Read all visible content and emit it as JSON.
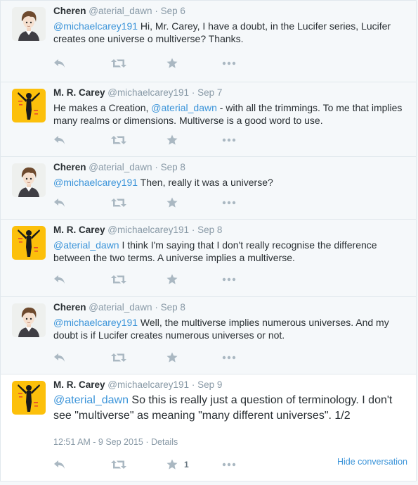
{
  "tweets": [
    {
      "name": "Cheren",
      "handle": "@aterial_dawn",
      "time": "Sep 6",
      "avatar": "cheren",
      "segments": [
        {
          "t": "@michaelcarey191",
          "m": true
        },
        {
          "t": " Hi, Mr. Carey, I have a doubt, in the Lucifer series, Lucifer creates one universe o multiverse? Thanks.",
          "m": false
        }
      ]
    },
    {
      "name": "M. R. Carey",
      "handle": "@michaelcarey191",
      "time": "Sep 7",
      "avatar": "carey",
      "segments": [
        {
          "t": "He makes a Creation, ",
          "m": false
        },
        {
          "t": "@aterial_dawn",
          "m": true
        },
        {
          "t": " - with all the trimmings. To me that implies many realms or dimensions. Multiverse is a good word to use.",
          "m": false
        }
      ]
    },
    {
      "name": "Cheren",
      "handle": "@aterial_dawn",
      "time": "Sep 8",
      "avatar": "cheren",
      "segments": [
        {
          "t": "@michaelcarey191",
          "m": true
        },
        {
          "t": " Then, really it was a universe?",
          "m": false
        }
      ]
    },
    {
      "name": "M. R. Carey",
      "handle": "@michaelcarey191",
      "time": "Sep 8",
      "avatar": "carey",
      "segments": [
        {
          "t": "@aterial_dawn",
          "m": true
        },
        {
          "t": " I think I'm saying that I don't really recognise the difference between the two terms. A universe implies a multiverse.",
          "m": false
        }
      ]
    },
    {
      "name": "Cheren",
      "handle": "@aterial_dawn",
      "time": "Sep 8",
      "avatar": "cheren",
      "segments": [
        {
          "t": "@michaelcarey191",
          "m": true
        },
        {
          "t": " Well,  the multiverse implies numerous universes. And my doubt is if Lucifer creates numerous universes or not.",
          "m": false
        }
      ]
    },
    {
      "name": "M. R. Carey",
      "handle": "@michaelcarey191",
      "time": "Sep 9",
      "avatar": "carey",
      "segments": [
        {
          "t": "@aterial_dawn",
          "m": true
        },
        {
          "t": " So this is really just a question of terminology. I don't see \"multiverse\" as meaning \"many different universes\". 1/2",
          "m": false
        }
      ]
    }
  ],
  "separator": "·",
  "focused": {
    "timestamp": "12:51 AM - 9 Sep 2015",
    "details_label": "Details",
    "favorite_count": "1",
    "hide_conversation_label": "Hide conversation"
  },
  "icons": [
    "reply-icon",
    "retweet-icon",
    "favorite-icon",
    "more-icon"
  ],
  "colors": {
    "link": "#3b94d9",
    "muted": "#8899a6",
    "icon": "#aab8c2",
    "background": "#f5f8fa",
    "border": "#e1e8ed",
    "avatar_yellow": "#fcc00b"
  }
}
